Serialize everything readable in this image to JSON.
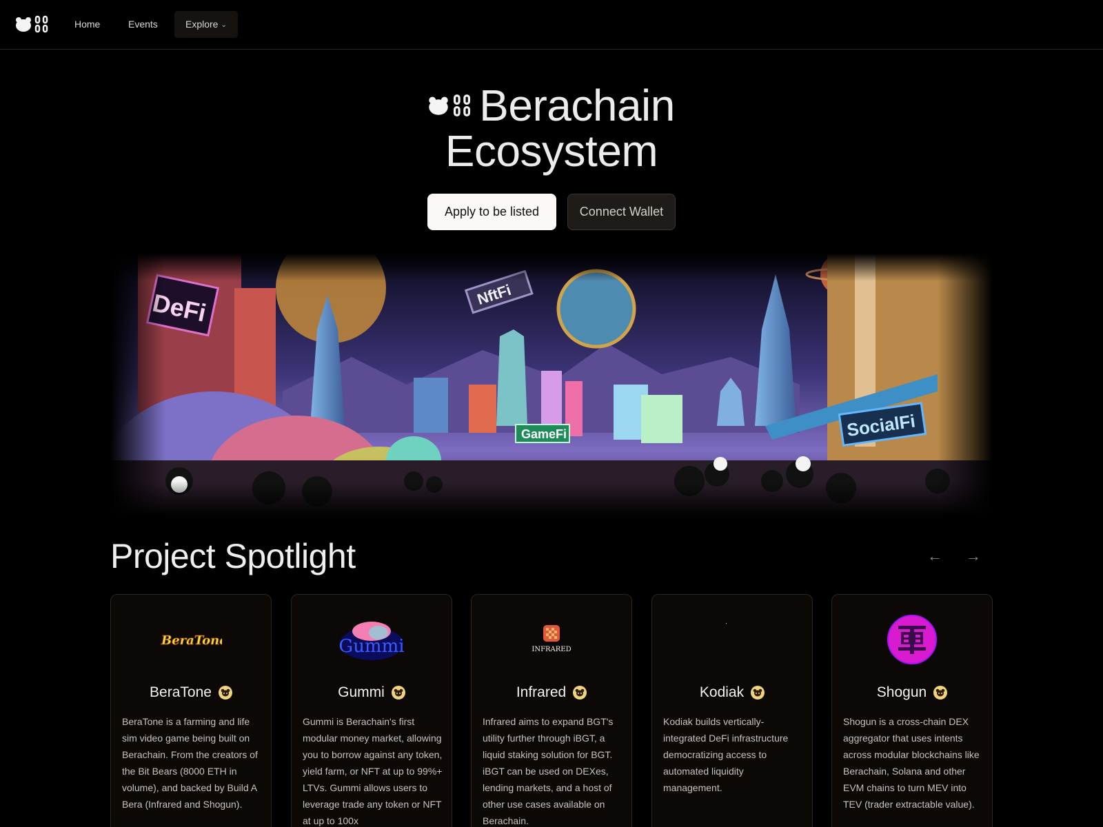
{
  "nav": {
    "logo_icon": "bera-chain-logo-icon",
    "items": [
      {
        "label": "Home"
      },
      {
        "label": "Events"
      },
      {
        "label": "Explore"
      }
    ]
  },
  "hero": {
    "title_line1": "Berachain",
    "title_line2": "Ecosystem",
    "apply_label": "Apply to be listed",
    "connect_label": "Connect Wallet"
  },
  "banner": {
    "signs": [
      "DeFi",
      "NftFi",
      "GameFi",
      "SocialFi"
    ]
  },
  "spotlight": {
    "title": "Project Spotlight",
    "prev_icon": "arrow-left-icon",
    "next_icon": "arrow-right-icon",
    "cards": [
      {
        "name": "BeraTone",
        "logo_text": "BeraTone",
        "description": "BeraTone is a farming and life sim video game being built on Berachain. From the creators of the Bit Bears (8000 ETH in volume), and backed by Build A Bera (Infrared and Shogun)."
      },
      {
        "name": "Gummi",
        "logo_text": "Gummi",
        "description": "Gummi is Berachain's first modular money market, allowing you to borrow against any token, yield farm, or NFT at up to 99%+ LTVs. Gummi allows users to leverage trade any token or NFT at up to 100x"
      },
      {
        "name": "Infrared",
        "logo_text": "INFRARED",
        "description": "Infrared aims to expand BGT's utility further through iBGT, a liquid staking solution for BGT. iBGT can be used on DEXes, lending markets, and a host of other use cases available on Berachain."
      },
      {
        "name": "Kodiak",
        "logo_text": "",
        "description": "Kodiak builds vertically-integrated DeFi infrastructure democratizing access to automated liquidity management."
      },
      {
        "name": "Shogun",
        "logo_text": "",
        "description": "Shogun is a cross-chain DEX aggregator that uses intents across modular blockchains like Berachain, Solana and other EVM chains to turn MEV into TEV (trader extractable value)."
      }
    ]
  }
}
